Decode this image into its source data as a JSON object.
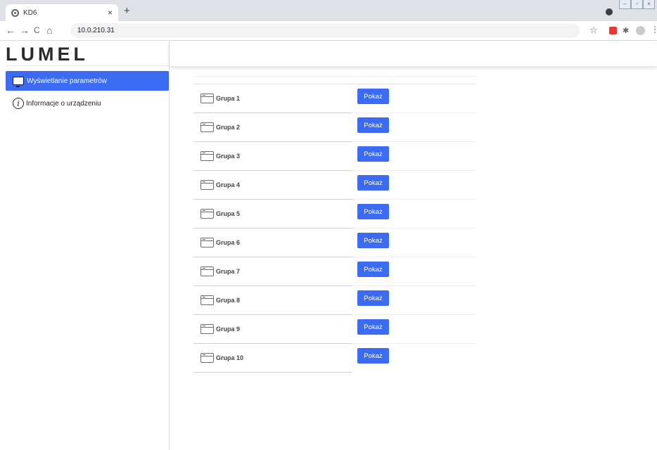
{
  "browser": {
    "tab_title": "KD6",
    "tab_close": "×",
    "new_tab": "+",
    "url": "10.0.210.31",
    "back": "←",
    "forward": "→",
    "reload": "C",
    "home": "⌂",
    "star": "☆",
    "ext": "✱",
    "menu": "⋮"
  },
  "app": {
    "logo": "LUMEL",
    "nav": {
      "items": [
        {
          "label": "Wyświetlanie parametrów",
          "icon": "monitor-icon",
          "active": true
        },
        {
          "label": "Informacje o urządzeniu",
          "icon": "info-icon",
          "active": false
        }
      ]
    },
    "groups": [
      {
        "label": "Grupa 1",
        "button": "Pokaż"
      },
      {
        "label": "Grupa 2",
        "button": "Pokaż"
      },
      {
        "label": "Grupa 3",
        "button": "Pokaż"
      },
      {
        "label": "Grupa 4",
        "button": "Pokaż"
      },
      {
        "label": "Grupa 5",
        "button": "Pokaż"
      },
      {
        "label": "Grupa 6",
        "button": "Pokaż"
      },
      {
        "label": "Grupa 7",
        "button": "Pokaż"
      },
      {
        "label": "Grupa 8",
        "button": "Pokaż"
      },
      {
        "label": "Grupa 9",
        "button": "Pokaż"
      },
      {
        "label": "Grupa 10",
        "button": "Pokaż"
      }
    ]
  },
  "colors": {
    "accent": "#3b6bf2",
    "chrome": "#dee1e6"
  }
}
